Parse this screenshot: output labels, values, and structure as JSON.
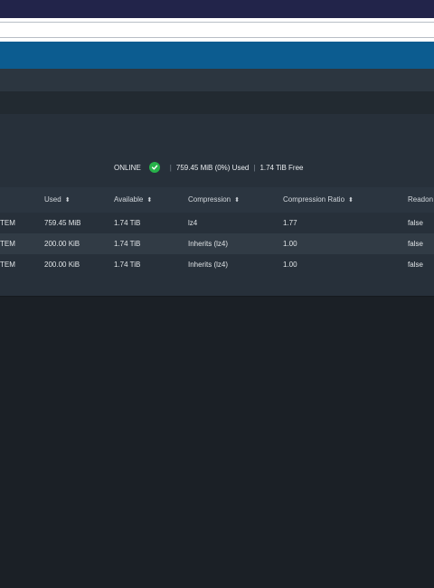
{
  "status": {
    "state": "ONLINE",
    "used": "759.45 MiB (0%) Used",
    "free": "1.74 TiB Free"
  },
  "table": {
    "columns": [
      "Used",
      "Available",
      "Compression",
      "Compression Ratio",
      "Readon"
    ],
    "rows": [
      {
        "name": "TEM",
        "used": "759.45 MiB",
        "available": "1.74 TiB",
        "compression": "lz4",
        "ratio": "1.77",
        "readonly": "false"
      },
      {
        "name": "TEM",
        "used": "200.00 KiB",
        "available": "1.74 TiB",
        "compression": "Inherits (lz4)",
        "ratio": "1.00",
        "readonly": "false"
      },
      {
        "name": "TEM",
        "used": "200.00 KiB",
        "available": "1.74 TiB",
        "compression": "Inherits (lz4)",
        "ratio": "1.00",
        "readonly": "false"
      }
    ]
  },
  "colors": {
    "online_check": "#27b24a",
    "header_blue": "#0c5c90"
  }
}
